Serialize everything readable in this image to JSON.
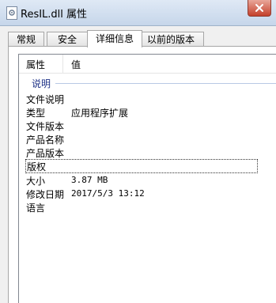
{
  "window": {
    "title": "ResIL.dll 属性"
  },
  "tabs": [
    {
      "label": "常规"
    },
    {
      "label": "安全"
    },
    {
      "label": "详细信息"
    },
    {
      "label": "以前的版本"
    }
  ],
  "details": {
    "headers": {
      "property": "属性",
      "value": "值"
    },
    "group": "说明",
    "rows": [
      {
        "name": "文件说明",
        "value": ""
      },
      {
        "name": "类型",
        "value": "应用程序扩展"
      },
      {
        "name": "文件版本",
        "value": ""
      },
      {
        "name": "产品名称",
        "value": ""
      },
      {
        "name": "产品版本",
        "value": ""
      },
      {
        "name": "版权",
        "value": ""
      },
      {
        "name": "大小",
        "value": "3.87 MB"
      },
      {
        "name": "修改日期",
        "value": "2017/5/3 13:12"
      },
      {
        "name": "语言",
        "value": ""
      }
    ]
  }
}
